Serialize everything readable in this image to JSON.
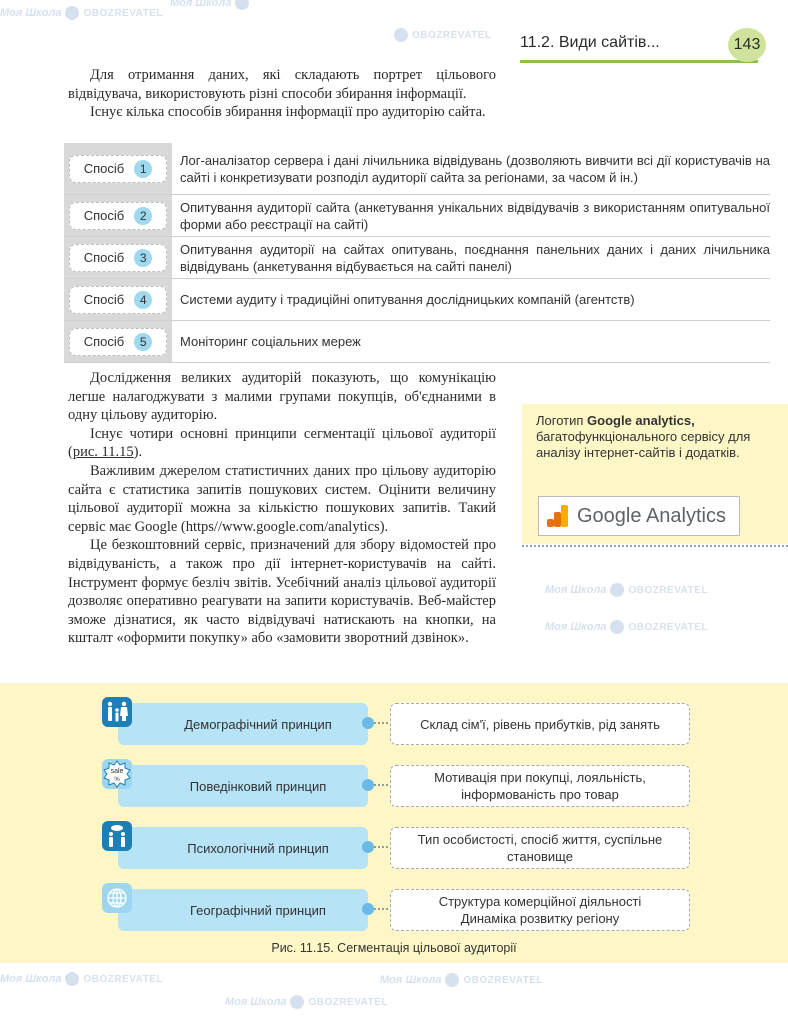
{
  "header": {
    "section_title": "11.2. Види сайтів...",
    "page_number": "143"
  },
  "watermark": {
    "brand1": "Моя Школа",
    "brand2": "OBOZREVATEL"
  },
  "intro": [
    "Для отримання даних, які складають портрет цільового відвідувача, використовують різні способи збирання інформації.",
    "Існує кілька способів збирання інформації про аудиторію сайта."
  ],
  "methods": {
    "label": "Спосіб",
    "items": [
      {
        "num": "1",
        "text": "Лог-аналізатор сервера і дані лічильника відвідувань (дозволяють вивчити всі дії користувачів на сайті і конкретизувати розподіл аудиторії сайта за регіонами, за часом й ін.)"
      },
      {
        "num": "2",
        "text": "Опитування аудиторії сайта (анкетування унікальних відвідувачів з використанням опитувальної форми або реєстрації на сайті)"
      },
      {
        "num": "3",
        "text": "Опитування аудиторії на сайтах опитувань, поєднання панельних даних і даних лічильника відвідувань (анкетування відбувається на сайті панелі)"
      },
      {
        "num": "4",
        "text": "Системи аудиту і традиційні опитування дослідницьких компаній (агентств)"
      },
      {
        "num": "5",
        "text": "Моніторинг соціальних мереж"
      }
    ]
  },
  "body": {
    "p1": "Дослідження великих аудиторій показують, що комунікацію легше налагоджувати з малими групами покупців, об'єднаними в одну цільову аудиторію.",
    "p2_before": "Існує чотири основні принципи сегментації цільової аудиторії (",
    "p2_link": "рис. 11.15",
    "p2_after": ").",
    "p3": "Важливим джерелом статистичних даних про цільову аудиторію сайта є статистика запитів пошукових систем. Оцінити величину цільової аудиторії можна за кількістю пошукових запитів. Такий сервіс має Google (https//www.google.com/analytics).",
    "p4": "Це безкоштовний сервіс, призначений для збору відомостей про відвідуваність, а також про дії інтернет-користувачів на сайті. Інструмент формує безліч звітів. Усебічний аналіз цільової аудиторії дозволяє оперативно реагувати на запити користувачів. Веб-майстер зможе дізнатися, як часто відвідувачі натискають на кнопки, на кшталт «оформити покупку» або «замовити зворотний дзвінок»."
  },
  "note": {
    "prefix": "Логотип ",
    "bold": "Google analytics,",
    "rest": " багатофункціонального сервісу для аналізу інтернет-сайтів і додатків.",
    "logo_text": "Google Analytics",
    "logo_colors": [
      "#f9ab00",
      "#e37400",
      "#e37400"
    ]
  },
  "figure": {
    "principles": [
      {
        "icon": "family-icon",
        "name": "Демографічний принцип",
        "desc": "Склад сім'ї, рівень прибутків, рід занять"
      },
      {
        "icon": "sale-badge-icon",
        "name": "Поведінковий принцип",
        "desc": "Мотивація при покупці, лояльність, інформованість про товар"
      },
      {
        "icon": "people-talking-icon",
        "name": "Психологічний принцип",
        "desc": "Тип особистості, спосіб життя, суспільне становище"
      },
      {
        "icon": "globe-icon",
        "name": "Географічний принцип",
        "desc": "Структура комерційної діяльності Динаміка розвитку регіону"
      }
    ],
    "caption": "Рис. 11.15. Сегментація цільової аудиторії",
    "sale_text": "sale",
    "percent_text": "%"
  }
}
